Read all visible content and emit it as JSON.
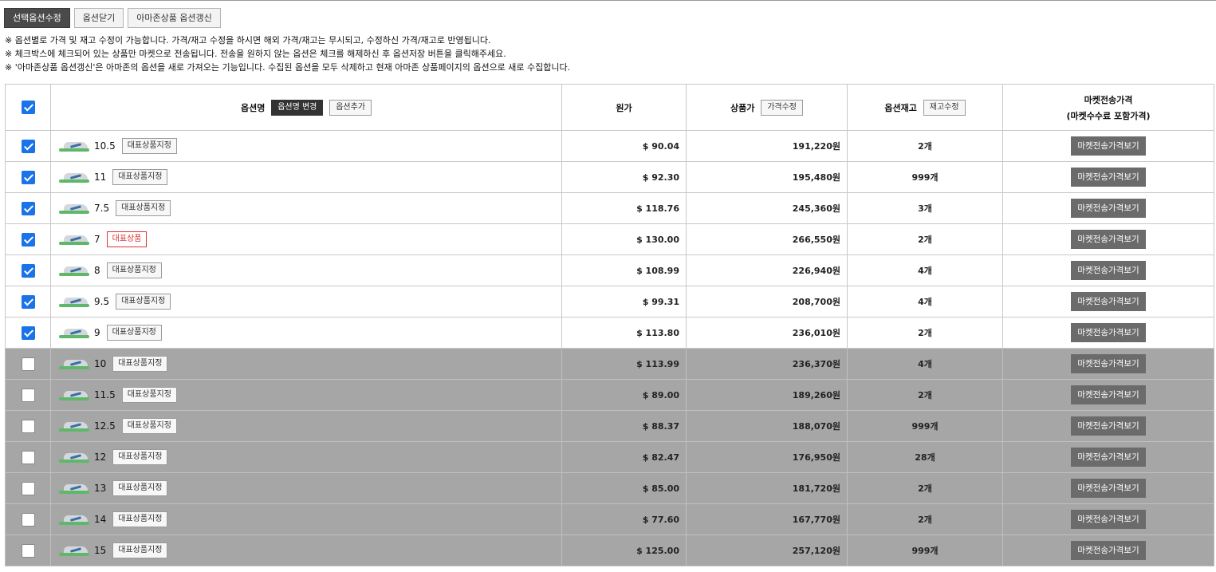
{
  "toolbar": {
    "edit_selected": "선택옵션수정",
    "close_options": "옵션닫기",
    "refresh_amazon": "아마존상품 옵션갱신"
  },
  "notes": [
    "※ 옵션별로 가격 및 재고 수정이 가능합니다. 가격/재고 수정을 하시면 해외 가격/재고는 무시되고, 수정하신 가격/재고로 반영됩니다.",
    "※ 체크박스에 체크되어 있는 상품만 마켓으로 전송됩니다. 전송을 원하지 않는 옵션은 체크를 해제하신 후 옵션저장 버튼을 클릭해주세요.",
    "※ '아마존상품 옵션갱신'은 아마존의 옵션을 새로 가져오는 기능입니다. 수집된 옵션을 모두 삭제하고 현재 아마존 상품페이지의 옵션으로 새로 수집합니다."
  ],
  "header": {
    "option_name": "옵션명",
    "change_name": "옵션명 변경",
    "add_option": "옵션추가",
    "original_price": "원가",
    "product_price": "상품가",
    "edit_price": "가격수정",
    "option_stock": "옵션재고",
    "edit_stock": "재고수정",
    "market_price_line1": "마켓전송가격",
    "market_price_line2": "(마켓수수료 포함가격)"
  },
  "labels": {
    "set_rep": "대표상품지정",
    "rep": "대표상품",
    "market_btn": "마켓전송가격보기"
  },
  "rows": [
    {
      "checked": true,
      "size": "10.5",
      "rep": false,
      "orig": "$ 90.04",
      "price": "191,220원",
      "stock": "2개"
    },
    {
      "checked": true,
      "size": "11",
      "rep": false,
      "orig": "$ 92.30",
      "price": "195,480원",
      "stock": "999개"
    },
    {
      "checked": true,
      "size": "7.5",
      "rep": false,
      "orig": "$ 118.76",
      "price": "245,360원",
      "stock": "3개"
    },
    {
      "checked": true,
      "size": "7",
      "rep": true,
      "orig": "$ 130.00",
      "price": "266,550원",
      "stock": "2개"
    },
    {
      "checked": true,
      "size": "8",
      "rep": false,
      "orig": "$ 108.99",
      "price": "226,940원",
      "stock": "4개"
    },
    {
      "checked": true,
      "size": "9.5",
      "rep": false,
      "orig": "$ 99.31",
      "price": "208,700원",
      "stock": "4개"
    },
    {
      "checked": true,
      "size": "9",
      "rep": false,
      "orig": "$ 113.80",
      "price": "236,010원",
      "stock": "2개"
    },
    {
      "checked": false,
      "size": "10",
      "rep": false,
      "orig": "$ 113.99",
      "price": "236,370원",
      "stock": "4개"
    },
    {
      "checked": false,
      "size": "11.5",
      "rep": false,
      "orig": "$ 89.00",
      "price": "189,260원",
      "stock": "2개"
    },
    {
      "checked": false,
      "size": "12.5",
      "rep": false,
      "orig": "$ 88.37",
      "price": "188,070원",
      "stock": "999개"
    },
    {
      "checked": false,
      "size": "12",
      "rep": false,
      "orig": "$ 82.47",
      "price": "176,950원",
      "stock": "28개"
    },
    {
      "checked": false,
      "size": "13",
      "rep": false,
      "orig": "$ 85.00",
      "price": "181,720원",
      "stock": "2개"
    },
    {
      "checked": false,
      "size": "14",
      "rep": false,
      "orig": "$ 77.60",
      "price": "167,770원",
      "stock": "2개"
    },
    {
      "checked": false,
      "size": "15",
      "rep": false,
      "orig": "$ 125.00",
      "price": "257,120원",
      "stock": "999개"
    }
  ],
  "colors": {
    "checkbox_checked": "#1a73e8",
    "unchecked_row_bg": "#a6a6a6",
    "rep_tag": "#dd3333",
    "market_button": "#6b6b6b"
  }
}
